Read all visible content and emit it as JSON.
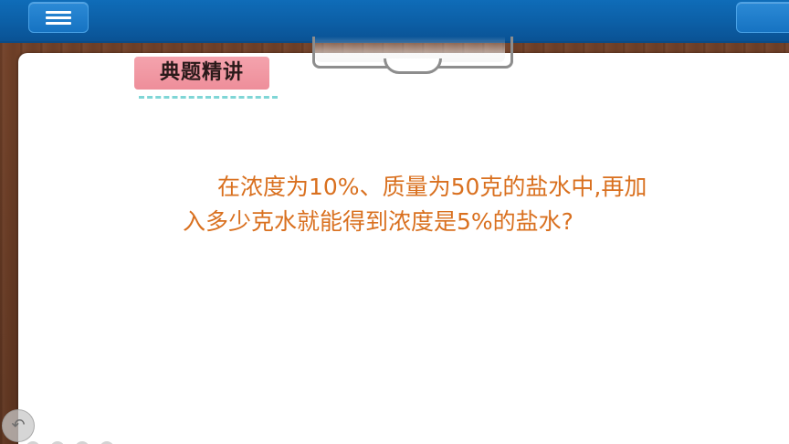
{
  "header": {
    "menu_icon": "hamburger-menu-icon",
    "right_button_icon": "",
    "bar_color": "#0c5fa6"
  },
  "lesson": {
    "section_title": "典题精讲",
    "question": "在浓度为10%、质量为50克的盐水中,再加入多少克水就能得到浓度是5%的盐水?",
    "text_color": "#d9701f",
    "tag_color": "#ee8e9a"
  },
  "footer": {
    "back_icon": "back-arrow-icon",
    "page_dot_count": 4
  }
}
